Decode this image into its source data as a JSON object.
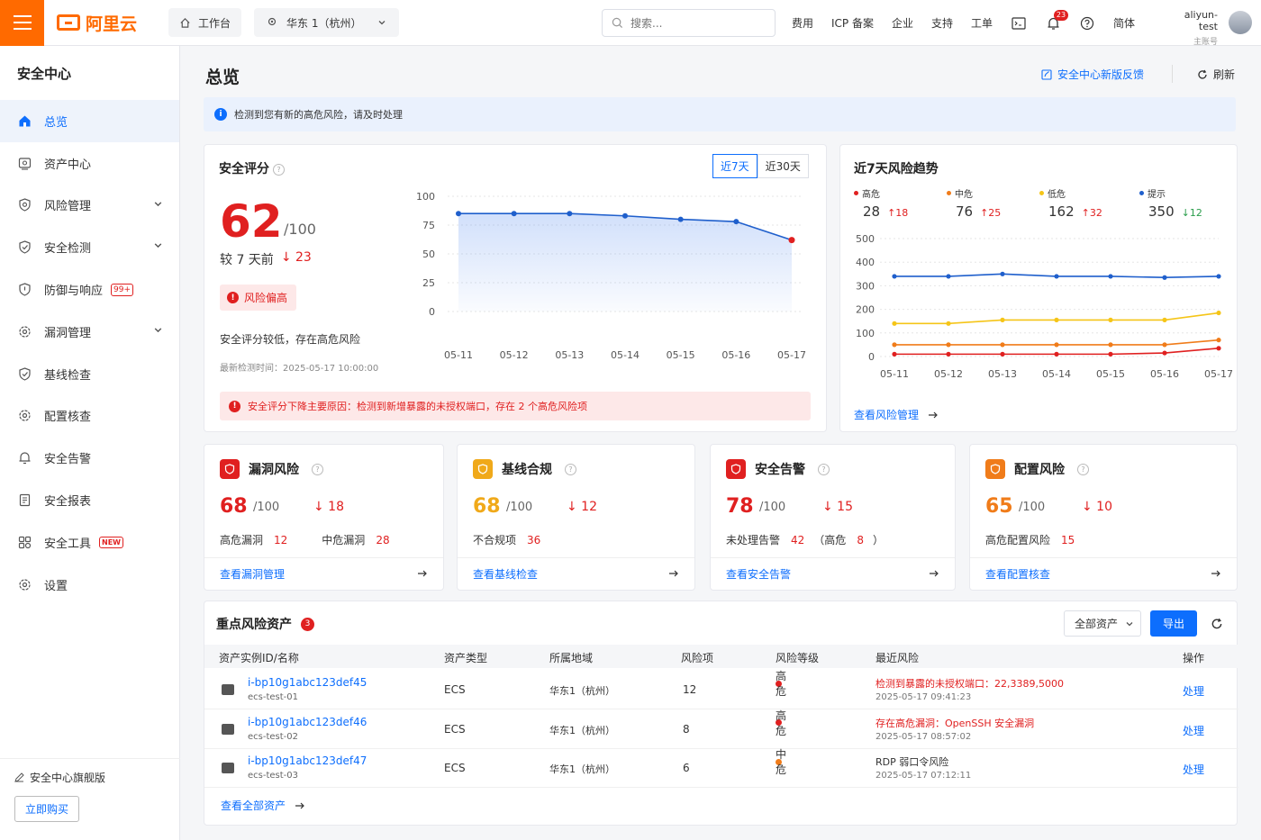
{
  "header": {
    "logo": "阿里云",
    "workbench": "工作台",
    "region": "华东 1（杭州）",
    "search_placeholder": "搜索...",
    "nav": [
      "费用",
      "ICP 备案",
      "企业",
      "支持",
      "工单"
    ],
    "notification_count": "23",
    "language": "简体",
    "user_name": "aliyun-test",
    "user_role": "主账号"
  },
  "sidebar": {
    "title": "安全中心",
    "items": [
      {
        "label": "总览",
        "icon": "home-icon"
      },
      {
        "label": "资产中心",
        "icon": "asset-icon"
      },
      {
        "label": "风险管理",
        "icon": "shield-icon"
      },
      {
        "label": "安全检测",
        "icon": "shield-check-icon"
      },
      {
        "label": "防御与响应",
        "icon": "shield-icon",
        "badge": "99+"
      },
      {
        "label": "漏洞管理",
        "icon": "gear-icon"
      },
      {
        "label": "基线检查",
        "icon": "shield-check-icon"
      },
      {
        "label": "配置核查",
        "icon": "gear-icon"
      },
      {
        "label": "安全告警",
        "icon": "bell-icon"
      },
      {
        "label": "安全报表",
        "icon": "report-icon"
      },
      {
        "label": "安全工具",
        "icon": "tools-icon",
        "badge": "NEW"
      },
      {
        "label": "设置",
        "icon": "gear-icon"
      }
    ],
    "edition": "安全中心旗舰版",
    "buy_label": "立即购买"
  },
  "page": {
    "title": "总览",
    "feedback": "安全中心新版反馈",
    "refresh": "刷新",
    "alert": "检测到您有新的高危风险，请及时处理"
  },
  "score_card": {
    "title": "安全评分",
    "tabs": [
      "近7天",
      "近30天"
    ],
    "score": "62",
    "out_of": "/100",
    "compare_label": "较 7 天前",
    "compare_delta": "↓ 23",
    "risk_tag": "风险偏高",
    "desc": "安全评分较低，存在高危风险",
    "last_check": "最新检测时间：2025-05-17 10:00:00",
    "reason": "安全评分下降主要原因：检测到新增暴露的未授权端口，存在 2 个高危风险项"
  },
  "trend_card": {
    "title": "近7天风险趋势",
    "legend": [
      {
        "name": "高危",
        "value": "28",
        "delta": "↑18",
        "dir": "up",
        "color": "#e02020"
      },
      {
        "name": "中危",
        "value": "76",
        "delta": "↑25",
        "dir": "up",
        "color": "#f07c1a"
      },
      {
        "name": "低危",
        "value": "162",
        "delta": "↑32",
        "dir": "up",
        "color": "#f5c518"
      },
      {
        "name": "提示",
        "value": "350",
        "delta": "↓12",
        "dir": "down",
        "color": "#1f5fcc"
      }
    ],
    "link": "查看风险管理"
  },
  "chart_data": [
    {
      "type": "area",
      "categories": [
        "05-11",
        "05-12",
        "05-13",
        "05-14",
        "05-15",
        "05-16",
        "05-17"
      ],
      "series": [
        {
          "values": [
            85,
            85,
            85,
            83,
            80,
            78,
            62
          ]
        }
      ],
      "ylim": [
        0,
        100
      ],
      "yticks": [
        0,
        25,
        50,
        75,
        100
      ],
      "title": "",
      "xlabel": "",
      "ylabel": ""
    },
    {
      "type": "line",
      "categories": [
        "05-11",
        "05-12",
        "05-13",
        "05-14",
        "05-15",
        "05-16",
        "05-17"
      ],
      "series": [
        {
          "name": "高危",
          "color": "#e02020",
          "values": [
            10,
            10,
            10,
            10,
            10,
            15,
            35
          ]
        },
        {
          "name": "中危",
          "color": "#f07c1a",
          "values": [
            50,
            50,
            50,
            50,
            50,
            50,
            70
          ]
        },
        {
          "name": "低危",
          "color": "#f5c518",
          "values": [
            140,
            140,
            155,
            155,
            155,
            155,
            185
          ]
        },
        {
          "name": "提示",
          "color": "#1f5fcc",
          "values": [
            340,
            340,
            350,
            340,
            340,
            335,
            340
          ]
        }
      ],
      "ylim": [
        0,
        500
      ],
      "yticks": [
        0,
        100,
        200,
        300,
        400,
        500
      ],
      "title": "",
      "xlabel": "",
      "ylabel": ""
    }
  ],
  "metric_cards": [
    {
      "title": "漏洞风险",
      "score": "68",
      "out_of": "/100",
      "delta": "↓ 18",
      "color": "#e02020",
      "sub": [
        {
          "label": "高危漏洞",
          "value": "12"
        },
        {
          "label": "中危漏洞",
          "value": "28"
        }
      ],
      "link": "查看漏洞管理"
    },
    {
      "title": "基线合规",
      "score": "68",
      "out_of": "/100",
      "delta": "↓ 12",
      "color": "#f0a91a",
      "sub": [
        {
          "label": "不合规项",
          "value": "36"
        }
      ],
      "link": "查看基线检查"
    },
    {
      "title": "安全告警",
      "score": "78",
      "out_of": "/100",
      "delta": "↓ 15",
      "color": "#e02020",
      "sub": [
        {
          "label": "未处理告警",
          "value": "42"
        },
        {
          "label": "（高危",
          "value": "8"
        },
        {
          "label": "）",
          "value": ""
        }
      ],
      "link": "查看安全告警"
    },
    {
      "title": "配置风险",
      "score": "65",
      "out_of": "/100",
      "delta": "↓ 10",
      "color": "#f07c1a",
      "sub": [
        {
          "label": "高危配置风险",
          "value": "15"
        }
      ],
      "link": "查看配置核查"
    }
  ],
  "assets": {
    "title": "重点风险资产",
    "count": "3",
    "filter": "全部资产",
    "export": "导出",
    "columns": [
      "资产实例ID/名称",
      "资产类型",
      "所属地域",
      "风险项",
      "风险等级",
      "最近风险",
      "操作"
    ],
    "rows": [
      {
        "id": "i-bp10g1abc123def45",
        "name": "ecs-test-01",
        "type": "ECS",
        "region": "华东1（杭州）",
        "risks": "12",
        "level": "高危",
        "level_color": "#e02020",
        "recent": "检测到暴露的未授权端口：22,3389,5000",
        "recent_red": true,
        "time": "2025-05-17 09:41:23",
        "action": "处理"
      },
      {
        "id": "i-bp10g1abc123def46",
        "name": "ecs-test-02",
        "type": "ECS",
        "region": "华东1（杭州）",
        "risks": "8",
        "level": "高危",
        "level_color": "#e02020",
        "recent": "存在高危漏洞：OpenSSH 安全漏洞",
        "recent_red": true,
        "time": "2025-05-17 08:57:02",
        "action": "处理"
      },
      {
        "id": "i-bp10g1abc123def47",
        "name": "ecs-test-03",
        "type": "ECS",
        "region": "华东1（杭州）",
        "risks": "6",
        "level": "中危",
        "level_color": "#f07c1a",
        "recent": "RDP 弱口令风险",
        "recent_red": false,
        "time": "2025-05-17 07:12:11",
        "action": "处理"
      }
    ],
    "view_all": "查看全部资产"
  }
}
